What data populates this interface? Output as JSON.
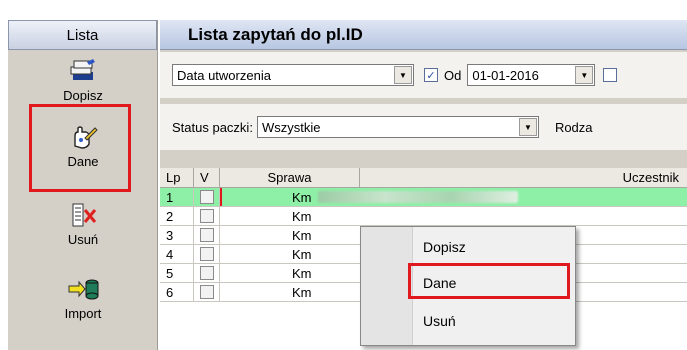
{
  "sidebar": {
    "header": "Lista",
    "tools": [
      {
        "label": "Dopisz",
        "icon": "stack-add-icon"
      },
      {
        "label": "Dane",
        "icon": "hand-edit-icon"
      },
      {
        "label": "Usuń",
        "icon": "list-delete-icon"
      },
      {
        "label": "Import",
        "icon": "import-db-icon"
      }
    ]
  },
  "main": {
    "title": "Lista zapytań do pl.ID",
    "date_field_select": "Data utworzenia",
    "from_checkbox_label": "Od",
    "from_checked": true,
    "from_date": "01-01-2016",
    "status_label": "Status paczki:",
    "status_select": "Wszystkie",
    "type_label_partial": "Rodza"
  },
  "grid": {
    "columns": [
      "Lp",
      "V",
      "Sprawa",
      "Uczestnik"
    ],
    "rows": [
      {
        "lp": "1",
        "sprawa": "Km"
      },
      {
        "lp": "2",
        "sprawa": "Km"
      },
      {
        "lp": "3",
        "sprawa": "Km"
      },
      {
        "lp": "4",
        "sprawa": "Km"
      },
      {
        "lp": "5",
        "sprawa": "Km"
      },
      {
        "lp": "6",
        "sprawa": "Km"
      }
    ]
  },
  "context_menu": {
    "items": [
      "Dopisz",
      "Dane",
      "Usuń"
    ],
    "highlighted": "Dane"
  },
  "colors": {
    "highlight_red": "#e0191f",
    "selected_row": "#8df0a6"
  }
}
